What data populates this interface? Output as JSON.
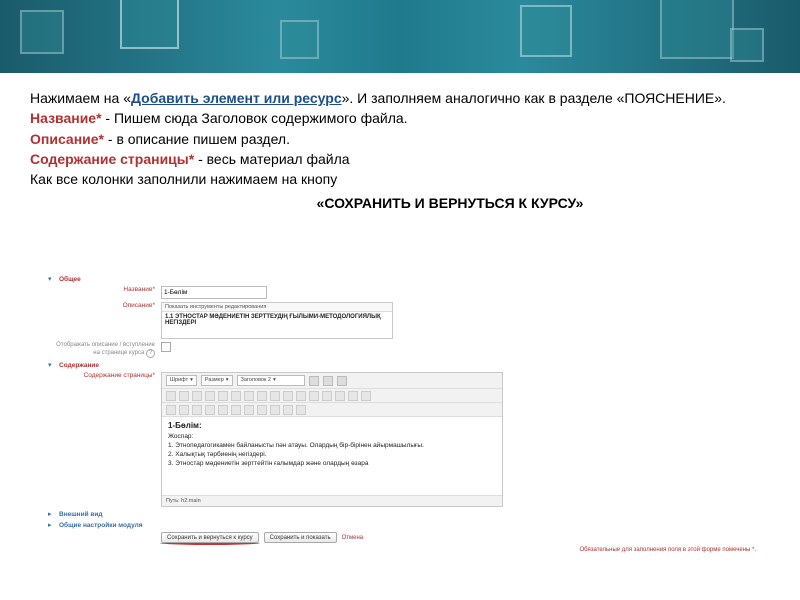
{
  "instructions": {
    "line1_prefix": "Нажимаем на «",
    "line1_link": "Добавить элемент или ресурс",
    "line1_suffix": "».  И заполняем аналогично как в разделе  «ПОЯСНЕНИЕ».",
    "line2_label": "Название*",
    "line2_text": " - Пишем сюда Заголовок содержимого файла.",
    "line3_label": "Описание*",
    "line3_text": " - в описание пишем раздел.",
    "line4_label": "Содержание страницы*",
    "line4_text": " - весь материал файла",
    "line5": "Как все колонки заполнили нажимаем на кнопу",
    "save_button_text": "«СОХРАНИТЬ И ВЕРНУТЬСЯ К КУРСУ»"
  },
  "form": {
    "section_general": "Общее",
    "name_label": "Название*",
    "name_value": "1-Бөлім",
    "desc_label": "Описание*",
    "desc_toolbar": "Показать инструменты редактирования",
    "desc_content": "1.1 ЭТНОСТАР МӘДЕНИЕТІН ЗЕРТТЕУДІҢ ҒЫЛЫМИ-МЕТОДОЛОГИЯЛЫҚ НЕГІЗДЕРІ",
    "show_desc_label": "Отображать описание / вступление на странице курса",
    "help_icon": "?",
    "section_content": "Содержание",
    "content_label": "Содержание страницы*",
    "editor": {
      "font_label": "Шрифт",
      "size_label": "Размер",
      "heading_label": "Заголовок 2",
      "body_title": "1-Бөлім:",
      "body_plan": "Жоспар:",
      "body_p1": "1. Этнопедагогикамен байланысты пән атауы. Олардың бір-бірінен айырмашылығы.",
      "body_p2": "2. Халықтық тәрбиенің негіздері.",
      "body_p3": "3. Этностар мәдениетін зерттейтін ғалымдар және олардың өзара",
      "path": "Путь: h2.main"
    },
    "section_appearance": "Внешний вид",
    "section_module": "Общие настройки модуля",
    "btn_save_return": "Сохранить и вернуться к курсу",
    "btn_save_show": "Сохранить и показать",
    "btn_cancel": "Отмена",
    "footnote": "Обязательные для заполнения поля в этой форме помечены *."
  }
}
